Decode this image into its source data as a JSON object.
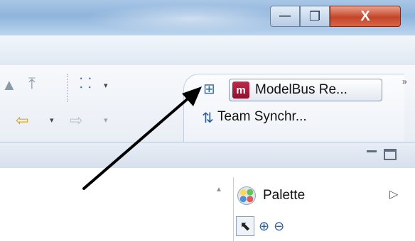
{
  "window_controls": {
    "minimize_glyph": "—",
    "maximize_glyph": "❐",
    "close_glyph": "X"
  },
  "toolbar": {
    "icons": [
      "navigate-up-icon",
      "navigate-top-icon",
      "structure-icon",
      "back-arrow-icon",
      "forward-arrow-icon"
    ],
    "dropdown_glyph": "▾",
    "more_glyph": "»"
  },
  "perspectives": {
    "open_perspective_icon": "open-perspective-icon",
    "modelbus_label": "ModelBus Re...",
    "team_sync_label": "Team Synchr..."
  },
  "editor": {
    "palette": {
      "label": "Palette",
      "toggle_glyph": "▷",
      "tools": [
        "select-icon",
        "zoom-in-icon",
        "zoom-out-icon"
      ]
    }
  },
  "colors": {
    "modelbus_logo": "#a51d3c",
    "close_button": "#c4452a",
    "title_bar": "#9dbde2"
  }
}
